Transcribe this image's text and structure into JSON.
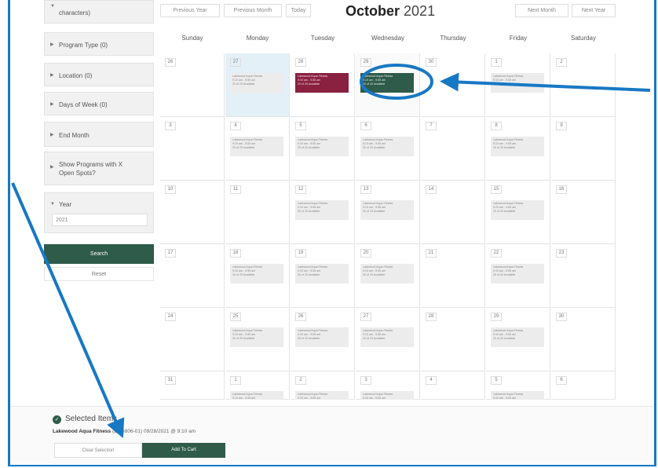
{
  "filters": [
    {
      "label": "characters)"
    },
    {
      "label": "Program Type (0)"
    },
    {
      "label": "Location (0)"
    },
    {
      "label": "Days of Week (0)"
    },
    {
      "label": "End Month"
    },
    {
      "label": "Show Programs with X"
    },
    {
      "label": "Open Spots?"
    },
    {
      "label": "Year"
    }
  ],
  "year_value": "2021",
  "search_label": "Search",
  "reset_label": "Reset",
  "nav": {
    "prev_year": "Previous Year",
    "prev_month": "Previous Month",
    "today": "Today",
    "next_month": "Next Month",
    "next_year": "Next Year"
  },
  "month": "October",
  "year": "2021",
  "weekdays": [
    "Sunday",
    "Monday",
    "Tuesday",
    "Wednesday",
    "Thursday",
    "Friday",
    "Saturday"
  ],
  "weeks": [
    [
      "26",
      "27",
      "28",
      "29",
      "30",
      "1",
      "2"
    ],
    [
      "3",
      "4",
      "5",
      "6",
      "7",
      "8",
      "9"
    ],
    [
      "10",
      "11",
      "12",
      "13",
      "14",
      "15",
      "16"
    ],
    [
      "17",
      "18",
      "19",
      "20",
      "21",
      "22",
      "23"
    ],
    [
      "24",
      "25",
      "26",
      "27",
      "28",
      "29",
      "30"
    ],
    [
      "31",
      "1",
      "2",
      "3",
      "4",
      "5",
      "6"
    ]
  ],
  "event": {
    "name": "Lakewood Aqua Fitness",
    "time": "9:10 am - 9:55 am",
    "avail": "20 of 20 Available"
  },
  "selected": {
    "title": "Selected Items",
    "item_name": "Lakewood Aqua Fitness",
    "item_detail": "(LWS806-01) 09/28/2021 @ 9:10 am",
    "clear_label": "Clear Selection",
    "cart_label": "Add To Cart"
  },
  "colors": {
    "accent_green": "#2e5b4a",
    "selected_red": "#8a2140",
    "annotation_blue": "#1778c4"
  }
}
